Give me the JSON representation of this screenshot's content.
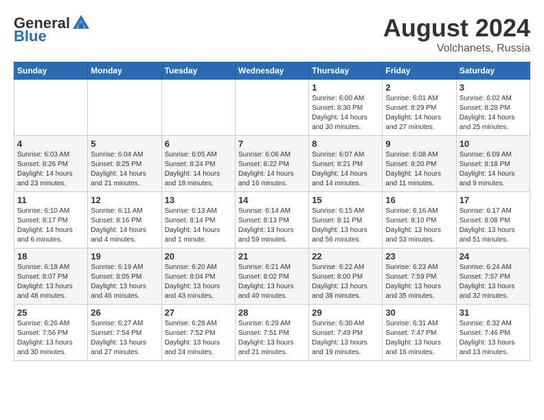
{
  "header": {
    "logo_general": "General",
    "logo_blue": "Blue",
    "month_year": "August 2024",
    "location": "Volchanets, Russia"
  },
  "weekdays": [
    "Sunday",
    "Monday",
    "Tuesday",
    "Wednesday",
    "Thursday",
    "Friday",
    "Saturday"
  ],
  "weeks": [
    [
      {
        "day": "",
        "info": ""
      },
      {
        "day": "",
        "info": ""
      },
      {
        "day": "",
        "info": ""
      },
      {
        "day": "",
        "info": ""
      },
      {
        "day": "1",
        "info": "Sunrise: 6:00 AM\nSunset: 8:30 PM\nDaylight: 14 hours\nand 30 minutes."
      },
      {
        "day": "2",
        "info": "Sunrise: 6:01 AM\nSunset: 8:29 PM\nDaylight: 14 hours\nand 27 minutes."
      },
      {
        "day": "3",
        "info": "Sunrise: 6:02 AM\nSunset: 8:28 PM\nDaylight: 14 hours\nand 25 minutes."
      }
    ],
    [
      {
        "day": "4",
        "info": "Sunrise: 6:03 AM\nSunset: 8:26 PM\nDaylight: 14 hours\nand 23 minutes."
      },
      {
        "day": "5",
        "info": "Sunrise: 6:04 AM\nSunset: 8:25 PM\nDaylight: 14 hours\nand 21 minutes."
      },
      {
        "day": "6",
        "info": "Sunrise: 6:05 AM\nSunset: 8:24 PM\nDaylight: 14 hours\nand 18 minutes."
      },
      {
        "day": "7",
        "info": "Sunrise: 6:06 AM\nSunset: 8:22 PM\nDaylight: 14 hours\nand 16 minutes."
      },
      {
        "day": "8",
        "info": "Sunrise: 6:07 AM\nSunset: 8:21 PM\nDaylight: 14 hours\nand 14 minutes."
      },
      {
        "day": "9",
        "info": "Sunrise: 6:08 AM\nSunset: 8:20 PM\nDaylight: 14 hours\nand 11 minutes."
      },
      {
        "day": "10",
        "info": "Sunrise: 6:09 AM\nSunset: 8:18 PM\nDaylight: 14 hours\nand 9 minutes."
      }
    ],
    [
      {
        "day": "11",
        "info": "Sunrise: 6:10 AM\nSunset: 8:17 PM\nDaylight: 14 hours\nand 6 minutes."
      },
      {
        "day": "12",
        "info": "Sunrise: 6:11 AM\nSunset: 8:16 PM\nDaylight: 14 hours\nand 4 minutes."
      },
      {
        "day": "13",
        "info": "Sunrise: 6:13 AM\nSunset: 8:14 PM\nDaylight: 14 hours\nand 1 minute."
      },
      {
        "day": "14",
        "info": "Sunrise: 6:14 AM\nSunset: 8:13 PM\nDaylight: 13 hours\nand 59 minutes."
      },
      {
        "day": "15",
        "info": "Sunrise: 6:15 AM\nSunset: 8:11 PM\nDaylight: 13 hours\nand 56 minutes."
      },
      {
        "day": "16",
        "info": "Sunrise: 6:16 AM\nSunset: 8:10 PM\nDaylight: 13 hours\nand 53 minutes."
      },
      {
        "day": "17",
        "info": "Sunrise: 6:17 AM\nSunset: 8:08 PM\nDaylight: 13 hours\nand 51 minutes."
      }
    ],
    [
      {
        "day": "18",
        "info": "Sunrise: 6:18 AM\nSunset: 8:07 PM\nDaylight: 13 hours\nand 48 minutes."
      },
      {
        "day": "19",
        "info": "Sunrise: 6:19 AM\nSunset: 8:05 PM\nDaylight: 13 hours\nand 46 minutes."
      },
      {
        "day": "20",
        "info": "Sunrise: 6:20 AM\nSunset: 8:04 PM\nDaylight: 13 hours\nand 43 minutes."
      },
      {
        "day": "21",
        "info": "Sunrise: 6:21 AM\nSunset: 8:02 PM\nDaylight: 13 hours\nand 40 minutes."
      },
      {
        "day": "22",
        "info": "Sunrise: 6:22 AM\nSunset: 8:00 PM\nDaylight: 13 hours\nand 38 minutes."
      },
      {
        "day": "23",
        "info": "Sunrise: 6:23 AM\nSunset: 7:59 PM\nDaylight: 13 hours\nand 35 minutes."
      },
      {
        "day": "24",
        "info": "Sunrise: 6:24 AM\nSunset: 7:57 PM\nDaylight: 13 hours\nand 32 minutes."
      }
    ],
    [
      {
        "day": "25",
        "info": "Sunrise: 6:26 AM\nSunset: 7:56 PM\nDaylight: 13 hours\nand 30 minutes."
      },
      {
        "day": "26",
        "info": "Sunrise: 6:27 AM\nSunset: 7:54 PM\nDaylight: 13 hours\nand 27 minutes."
      },
      {
        "day": "27",
        "info": "Sunrise: 6:28 AM\nSunset: 7:52 PM\nDaylight: 13 hours\nand 24 minutes."
      },
      {
        "day": "28",
        "info": "Sunrise: 6:29 AM\nSunset: 7:51 PM\nDaylight: 13 hours\nand 21 minutes."
      },
      {
        "day": "29",
        "info": "Sunrise: 6:30 AM\nSunset: 7:49 PM\nDaylight: 13 hours\nand 19 minutes."
      },
      {
        "day": "30",
        "info": "Sunrise: 6:31 AM\nSunset: 7:47 PM\nDaylight: 13 hours\nand 16 minutes."
      },
      {
        "day": "31",
        "info": "Sunrise: 6:32 AM\nSunset: 7:46 PM\nDaylight: 13 hours\nand 13 minutes."
      }
    ]
  ]
}
